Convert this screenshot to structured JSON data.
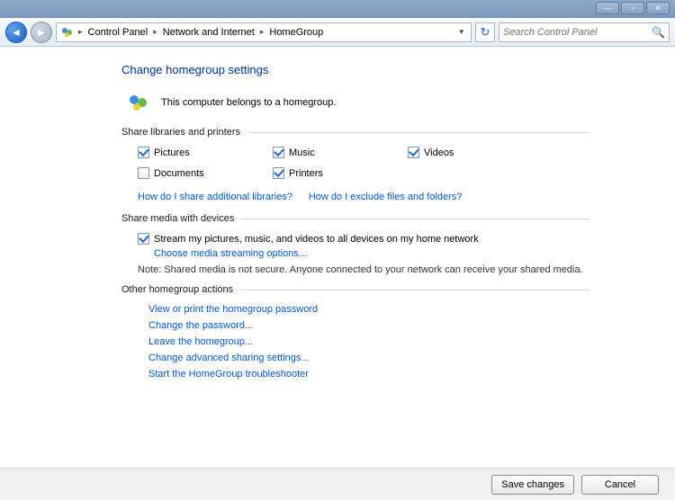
{
  "titlebar": {
    "min": "—",
    "restore": "▫",
    "close": "✕"
  },
  "breadcrumb": {
    "root": "Control Panel",
    "mid": "Network and Internet",
    "leaf": "HomeGroup"
  },
  "search": {
    "placeholder": "Search Control Panel"
  },
  "page": {
    "title": "Change homegroup settings",
    "status": "This computer belongs to a homegroup."
  },
  "sections": {
    "share_libs": "Share libraries and printers",
    "share_media": "Share media with devices",
    "other_actions": "Other homegroup actions"
  },
  "checkboxes": {
    "pictures": "Pictures",
    "music": "Music",
    "videos": "Videos",
    "documents": "Documents",
    "printers": "Printers"
  },
  "links": {
    "share_additional": "How do I share additional libraries?",
    "exclude": "How do I exclude files and folders?",
    "stream_options": "Choose media streaming options...",
    "view_password": "View or print the homegroup password",
    "change_password": "Change the password...",
    "leave": "Leave the homegroup...",
    "advanced_sharing": "Change advanced sharing settings...",
    "troubleshooter": "Start the HomeGroup troubleshooter"
  },
  "stream": {
    "label": "Stream my pictures, music, and videos to all devices on my home network",
    "note": "Note: Shared media is not secure. Anyone connected to your network can receive your shared media."
  },
  "buttons": {
    "save": "Save changes",
    "cancel": "Cancel"
  }
}
